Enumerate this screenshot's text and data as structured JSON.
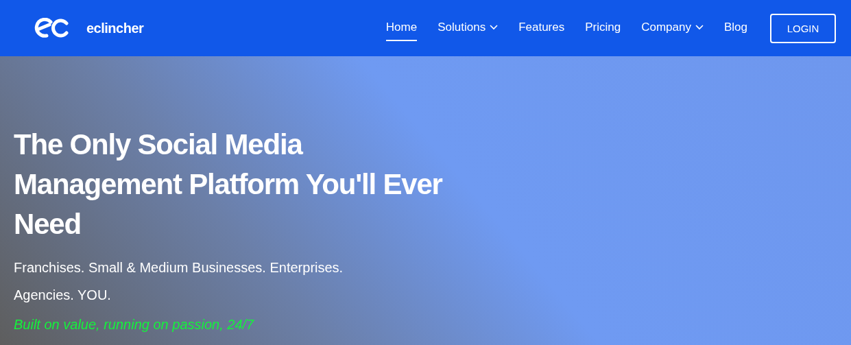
{
  "header": {
    "brand": "eclincher",
    "nav": [
      {
        "label": "Home",
        "selected": true,
        "dropdown": false
      },
      {
        "label": "Solutions",
        "selected": false,
        "dropdown": true
      },
      {
        "label": "Features",
        "selected": false,
        "dropdown": false
      },
      {
        "label": "Pricing",
        "selected": false,
        "dropdown": false
      },
      {
        "label": "Company",
        "selected": false,
        "dropdown": true
      },
      {
        "label": "Blog",
        "selected": false,
        "dropdown": false
      }
    ],
    "login": "LOGIN"
  },
  "hero": {
    "heading": "The Only Social Media Management Platform You'll Ever Need",
    "subtitle": "Franchises. Small & Medium Businesses. Enterprises. Agencies. YOU.",
    "tagline": "Built on value, running on passion, 24/7"
  }
}
